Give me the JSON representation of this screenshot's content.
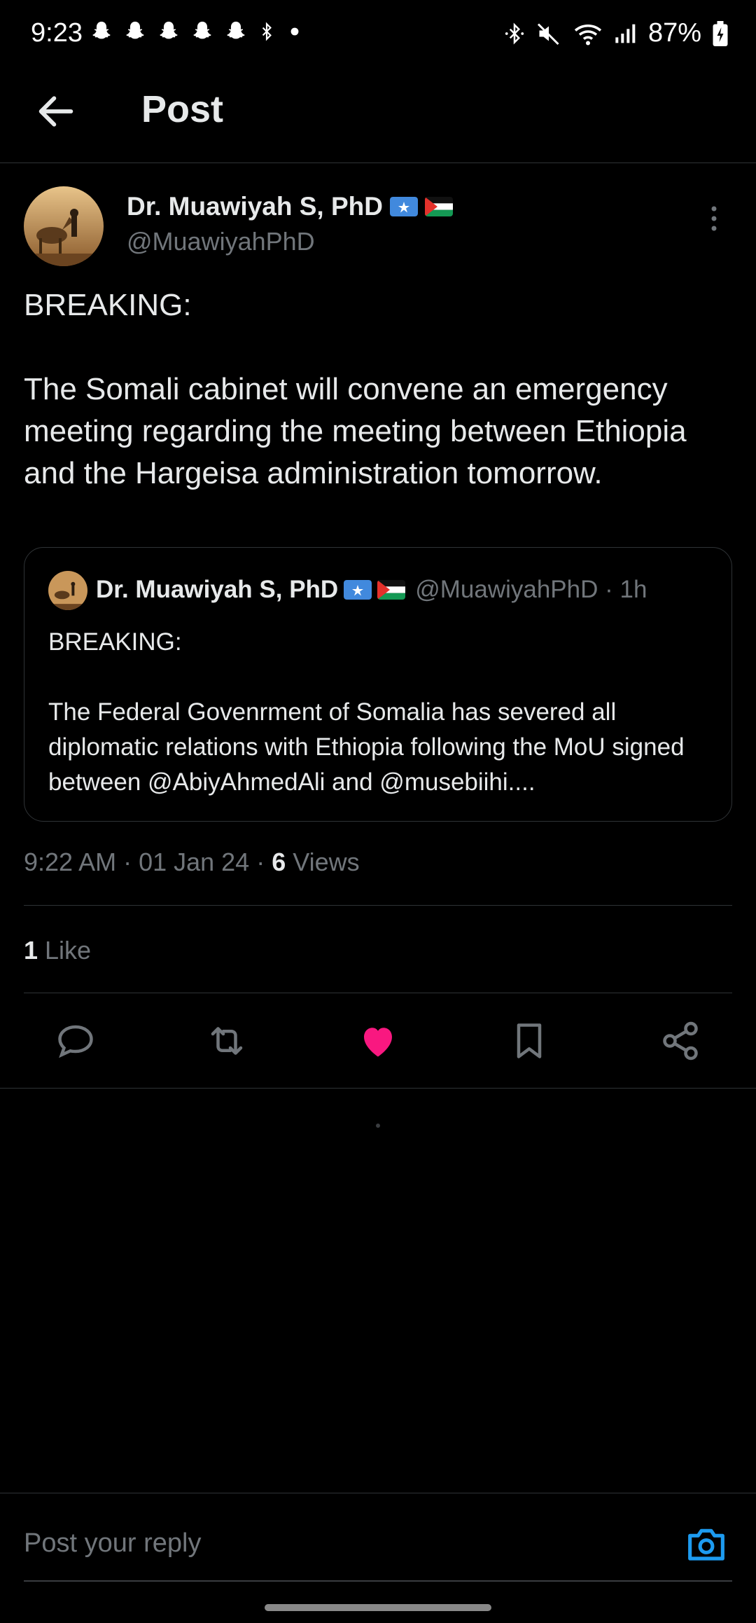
{
  "status_bar": {
    "time": "9:23",
    "battery": "87%",
    "icons": [
      "snapchat-icon",
      "snapchat-icon",
      "snapchat-icon",
      "snapchat-icon",
      "snapchat-icon",
      "bluetooth-icon",
      "dot-icon",
      "bluetooth-icon",
      "mute-icon",
      "wifi-icon",
      "signal-icon",
      "battery-charging-icon"
    ]
  },
  "header": {
    "title": "Post"
  },
  "post": {
    "author_name": "Dr. Muawiyah S, PhD",
    "author_handle": "@MuawiyahPhD",
    "flags": [
      "somalia-flag",
      "palestine-flag"
    ],
    "text": "BREAKING:\n\nThe Somali cabinet will convene an emergency meeting regarding the meeting between Ethiopia and the Hargeisa administration tomorrow.",
    "quoted": {
      "author_name": "Dr. Muawiyah S, PhD",
      "author_handle": "@MuawiyahPhD · 1h",
      "text": "BREAKING:\n\nThe Federal Govenrment of Somalia has severed all diplomatic relations with Ethiopia following the MoU signed between @AbiyAhmedAli and @musebiihi...."
    },
    "meta_prefix": "9:22 AM · 01 Jan 24 · ",
    "views_count": "6",
    "views_label": " Views",
    "likes_count": "1",
    "likes_label": " Like"
  },
  "actions": [
    "reply-icon",
    "repost-icon",
    "like-icon",
    "bookmark-icon",
    "share-icon"
  ],
  "colors": {
    "like": "#f91880",
    "accent": "#1d9bf0",
    "muted": "#71767b"
  },
  "reply": {
    "placeholder": "Post your reply"
  }
}
